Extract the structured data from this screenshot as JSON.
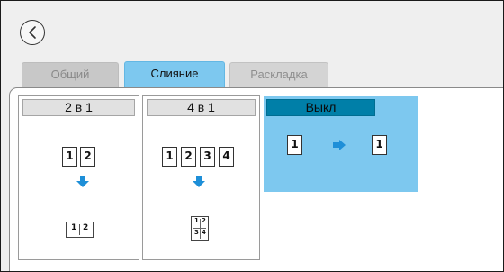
{
  "tabs": {
    "general": "Общий",
    "merge": "Слияние",
    "layout": "Раскладка"
  },
  "cards": {
    "two_in_one": {
      "label": "2 в 1",
      "pages": [
        "1",
        "2"
      ],
      "result": [
        "1",
        "2"
      ]
    },
    "four_in_one": {
      "label": "4 в 1",
      "pages": [
        "1",
        "2",
        "3",
        "4"
      ],
      "result": [
        "1",
        "2",
        "3",
        "4"
      ]
    },
    "off": {
      "label": "Выкл",
      "source": "1",
      "result": "1",
      "selected": true
    }
  },
  "colors": {
    "accent": "#7dc8ef",
    "selected_header": "#007fa8",
    "arrow": "#1e8fd8"
  },
  "icons": {
    "back": "chevron-left-icon",
    "arrow_down": "arrow-down-icon",
    "arrow_right": "arrow-right-icon"
  }
}
